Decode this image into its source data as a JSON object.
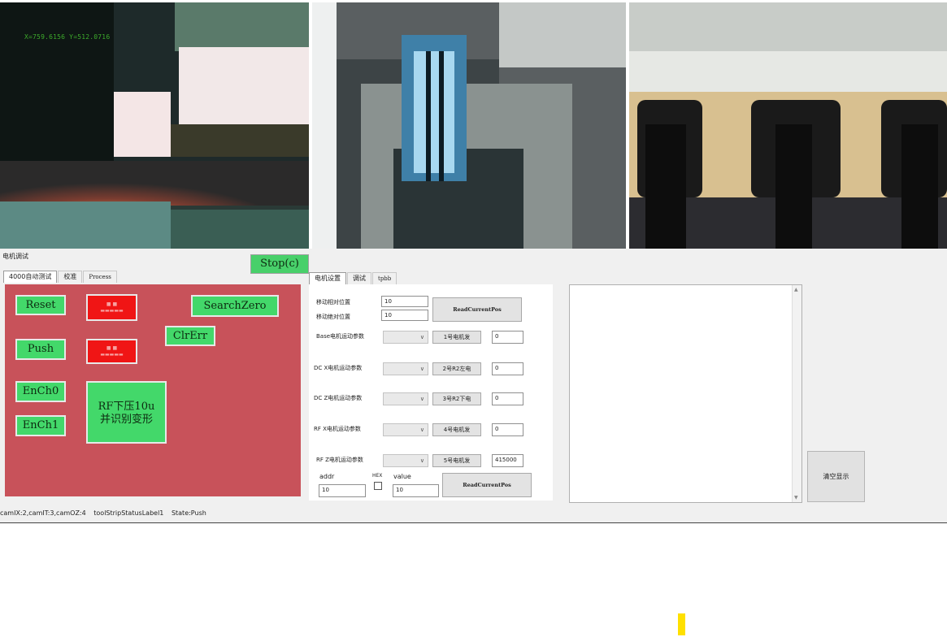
{
  "cameras": [
    {
      "overlay": "X=759.6156 Y=512.0716"
    },
    {
      "overlay": ""
    },
    {
      "overlay": ""
    }
  ],
  "group_title": "电机调试",
  "stop_button": "Stop(c)",
  "left_tabs": [
    "4000自动测试",
    "校准",
    "Process"
  ],
  "red_panel": {
    "reset": "Reset",
    "search_zero": "SearchZero",
    "clr_err": "ClrErr",
    "push": "Push",
    "ench0": "EnCh0",
    "ench1": "EnCh1",
    "rf_press": "RF下压10u\n并识别变形"
  },
  "mid_tabs": [
    "电机设置",
    "调试",
    "tpbb"
  ],
  "mid_panel": {
    "move_relative_label": "移动相对位置",
    "move_relative_value": "10",
    "move_absolute_label": "移动绝对位置",
    "move_absolute_value": "10",
    "read_current_pos": "ReadCurrentPos",
    "motors": [
      {
        "label": "Base电机运动参数",
        "button": "1号电机发",
        "value": "0"
      },
      {
        "label": "DC X电机运动参数",
        "button": "2号R2左电",
        "value": "0"
      },
      {
        "label": "DC Z电机运动参数",
        "button": "3号R2下电",
        "value": "0"
      },
      {
        "label": "RF X电机运动参数",
        "button": "4号电机发",
        "value": "0"
      },
      {
        "label": "RF Z电机运动参数",
        "button": "5号电机发",
        "value": "415000"
      }
    ],
    "addr_label": "addr",
    "addr_value": "10",
    "hex_label": "HEX",
    "value_label": "value",
    "value_value": "10",
    "read_current_pos_2": "ReadCurrentPos"
  },
  "clear_display": "清空显示",
  "status_bar": [
    "camIX:2,camIT:3,camOZ:4",
    "toolStripStatusLabel1",
    "State:Push"
  ]
}
